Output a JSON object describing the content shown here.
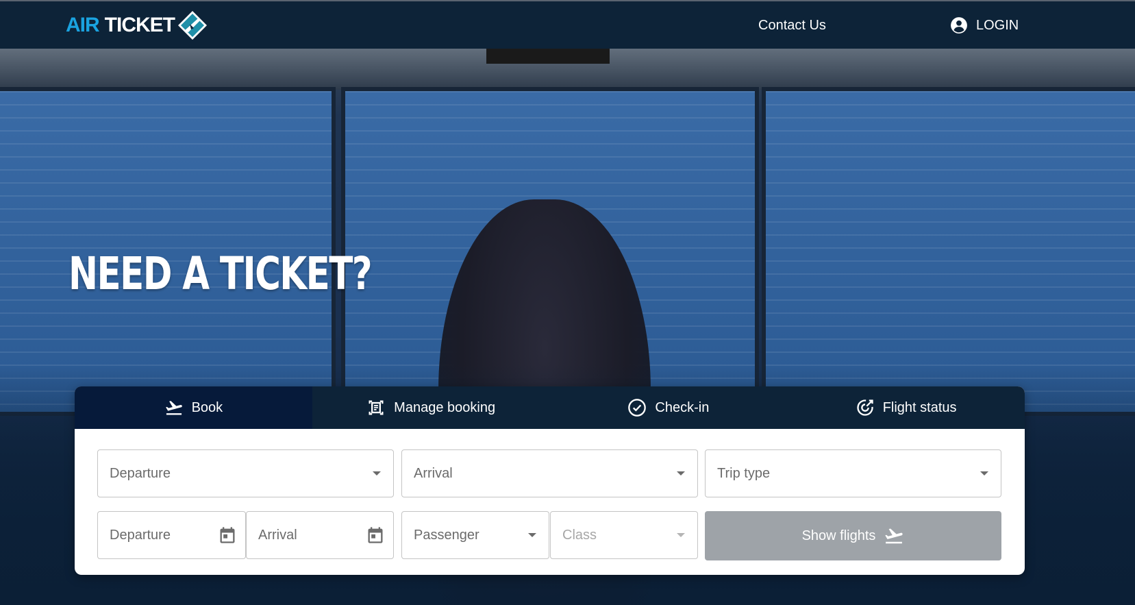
{
  "header": {
    "logo_air": "AIR",
    "logo_ticket": "TICKET",
    "contact": "Contact Us",
    "login": "LOGIN"
  },
  "hero": {
    "title": "NEED A TICKET?"
  },
  "tabs": [
    {
      "label": "Book",
      "icon": "plane-takeoff-icon",
      "active": true
    },
    {
      "label": "Manage booking",
      "icon": "booking-document-icon",
      "active": false
    },
    {
      "label": "Check-in",
      "icon": "check-circle-icon",
      "active": false
    },
    {
      "label": "Flight status",
      "icon": "flight-status-icon",
      "active": false
    }
  ],
  "form": {
    "departure": "Departure",
    "arrival": "Arrival",
    "trip_type": "Trip type",
    "departure_date": "Departure",
    "arrival_date": "Arrival",
    "passenger": "Passenger",
    "class": "Class",
    "submit": "Show flights"
  },
  "colors": {
    "navbar": "#0d2338",
    "brand_blue": "#1aa3e0",
    "active_tab": "#061a3a",
    "button_disabled": "#9ea3a8"
  }
}
